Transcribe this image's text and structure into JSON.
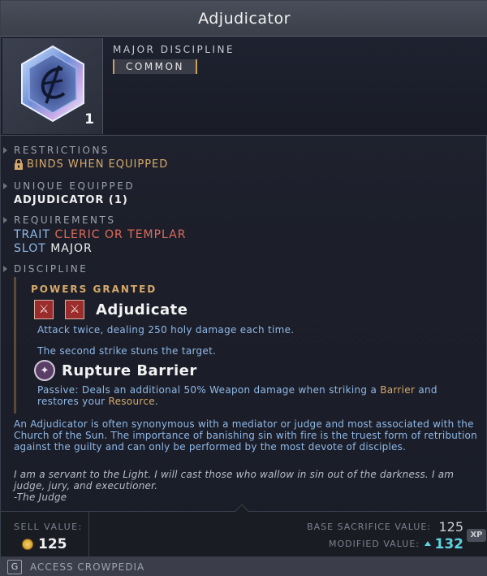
{
  "title": "Adjudicator",
  "header": {
    "item_type": "MAJOR DISCIPLINE",
    "rarity": "COMMON",
    "stack_count": "1",
    "icon": "discipline-gem-icon"
  },
  "sections": {
    "restrictions_label": "RESTRICTIONS",
    "restrictions_value": "BINDS WHEN EQUIPPED",
    "unique_label": "UNIQUE EQUIPPED",
    "unique_value": "ADJUDICATOR (1)",
    "requirements_label": "REQUIREMENTS",
    "trait_key": "TRAIT",
    "trait_value": "CLERIC OR TEMPLAR",
    "slot_key": "SLOT",
    "slot_value": "MAJOR",
    "discipline_label": "DISCIPLINE"
  },
  "discipline": {
    "powers_label": "POWERS GRANTED",
    "power1": {
      "name": "Adjudicate",
      "desc1": "Attack twice, dealing 250 holy damage each time.",
      "desc2": "The second strike stuns the target."
    },
    "power2": {
      "name": "Rupture Barrier",
      "desc_a": "Passive: Deals an additional 50% Weapon damage when striking a ",
      "desc_b": "Barrier",
      "desc_c": " and",
      "desc_d": "restores your ",
      "desc_e": "Resource",
      "desc_f": "."
    }
  },
  "lore": "An Adjudicator is often synonymous with a mediator or judge and most associated with the Church of the Sun. The importance of banishing sin with fire is the truest form of retribution against the guilty and can only be performed by the most devote of disciples.",
  "quote": {
    "line1": "I am a servant to the Light. I will cast those who wallow in sin out of the darkness. I am",
    "line2": "judge, jury, and executioner.",
    "attribution": "-The Judge"
  },
  "footer": {
    "sell_label": "SELL VALUE:",
    "sell_value": "125",
    "base_label": "BASE SACRIFICE VALUE:",
    "base_value": "125",
    "mod_label": "MODIFIED VALUE:",
    "mod_value": "132",
    "xp_badge": "XP"
  },
  "crowpedia": {
    "key": "G",
    "label": "ACCESS CROWPEDIA"
  },
  "colors": {
    "gold": "#d6a96a",
    "blue": "#8fb8e8",
    "red": "#e06a5a",
    "cyan": "#5fd3e0"
  }
}
